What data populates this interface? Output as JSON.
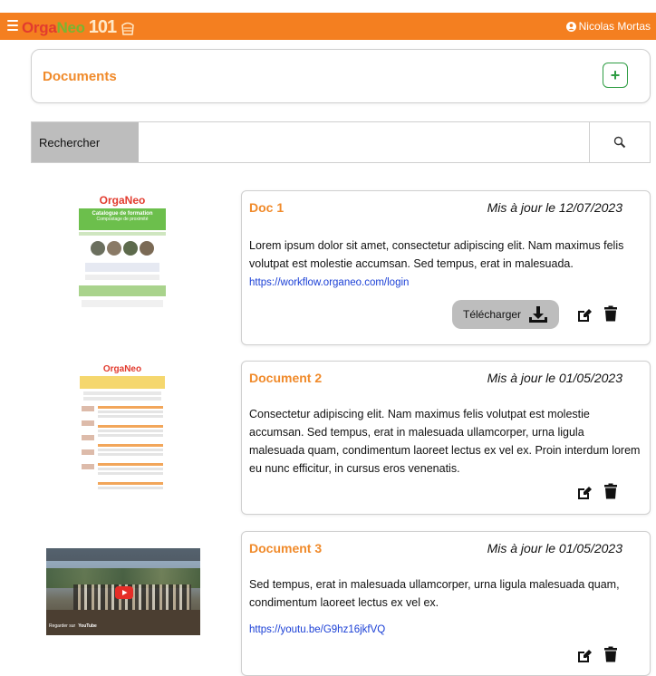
{
  "topbar": {
    "logo_part1": "Orga",
    "logo_part2": "Neo",
    "logo_part3": "101",
    "user_name": "Nicolas Mortas"
  },
  "header": {
    "title": "Documents",
    "add_label": "+"
  },
  "search": {
    "label": "Rechercher",
    "value": "",
    "placeholder": ""
  },
  "documents": [
    {
      "title": "Doc 1",
      "date": "Mis à jour le 12/07/2023",
      "text": "Lorem ipsum dolor sit amet, consectetur adipiscing elit. Nam maximus felis volutpat est molestie accumsan. Sed tempus, erat in malesuada.",
      "link": "https://workflow.organeo.com/login",
      "download_label": "Télécharger",
      "thumb_brand": "OrgaNeo",
      "thumb_title": "Catalogue de formation",
      "thumb_subtitle": "Compostage de proximité"
    },
    {
      "title": "Document 2",
      "date": "Mis à jour le 01/05/2023",
      "text": "Consectetur adipiscing elit. Nam maximus felis volutpat est molestie accumsan. Sed tempus, erat in malesuada ullamcorper, urna ligula malesuada quam, condimentum laoreet lectus ex vel ex. Proin interdum lorem eu nunc efficitur, in cursus eros venenatis.",
      "thumb_brand": "OrgaNeo"
    },
    {
      "title": "Document 3",
      "date": "Mis à jour le 01/05/2023",
      "text": "Sed tempus, erat in malesuada ullamcorper, urna ligula malesuada quam, condimentum laoreet lectus ex vel ex.",
      "link": "https://youtu.be/G9hz16jkfVQ",
      "video_watch": "Regarder sur",
      "video_brand": "YouTube"
    }
  ],
  "colors": {
    "topbar": "#f47f20",
    "accent_title": "#f08a2a",
    "add_green": "#2e9d43",
    "link_blue": "#1a3fd6",
    "button_grey": "#bdbdbd"
  }
}
